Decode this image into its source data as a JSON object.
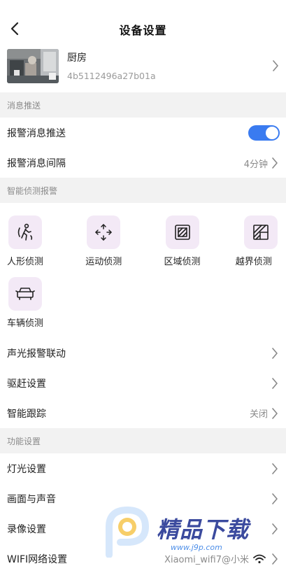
{
  "header": {
    "title": "设备设置"
  },
  "device": {
    "name": "厨房",
    "id": "4b5112496a27b01a"
  },
  "sections": {
    "push": "消息推送",
    "smart": "智能侦测报警",
    "function": "功能设置"
  },
  "push_rows": {
    "alarm_push": {
      "label": "报警消息推送",
      "enabled": true
    },
    "alarm_interval": {
      "label": "报警消息间隔",
      "value": "4分钟"
    }
  },
  "detections": [
    {
      "label": "人形侦测",
      "icon": "human-icon"
    },
    {
      "label": "运动侦测",
      "icon": "motion-arrows-icon"
    },
    {
      "label": "区域侦测",
      "icon": "area-icon"
    },
    {
      "label": "越界侦测",
      "icon": "boundary-icon"
    },
    {
      "label": "车辆侦测",
      "icon": "car-icon"
    }
  ],
  "smart_rows": {
    "sound_light": {
      "label": "声光报警联动"
    },
    "expel": {
      "label": "驱赶设置"
    },
    "tracking": {
      "label": "智能跟踪",
      "value": "关闭"
    }
  },
  "function_rows": {
    "light": {
      "label": "灯光设置"
    },
    "picture_sound": {
      "label": "画面与声音"
    },
    "record": {
      "label": "录像设置"
    },
    "wifi": {
      "label": "WIFI网络设置",
      "value": "Xiaomi_wifi7@小米"
    }
  },
  "watermark": {
    "title": "精品下载",
    "url": "www.j9p.com"
  },
  "colors": {
    "accent": "#3a7bf0",
    "icon_bg": "#f3e9f6",
    "section_bg": "#f2f2f2"
  }
}
